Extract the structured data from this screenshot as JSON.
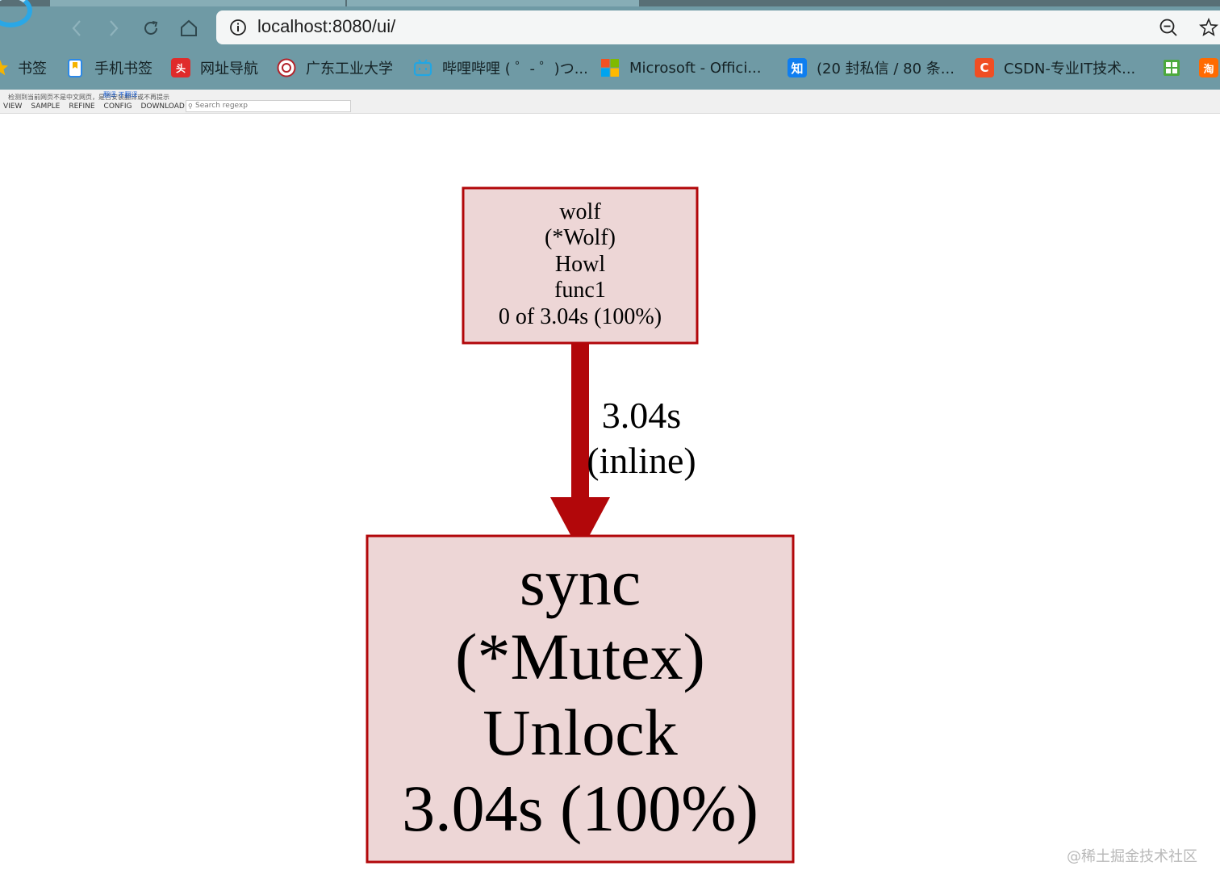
{
  "browser": {
    "url": "localhost:8080/ui/",
    "bookmarks": [
      {
        "label": "书签",
        "icon": "bookmark-star-icon",
        "color": "#f5b400"
      },
      {
        "label": "手机书签",
        "icon": "mobile-bookmark-icon",
        "color": "#2b88e8"
      },
      {
        "label": "网址导航",
        "icon": "navigation-icon",
        "color": "#e02b2b",
        "glyph": "头"
      },
      {
        "label": "广东工业大学",
        "icon": "university-seal-icon",
        "color": "#b3232b"
      },
      {
        "label": "哔哩哔哩 ( ゜- ゜)つ...",
        "icon": "bilibili-icon",
        "color": "#22a6e3"
      },
      {
        "label": "Microsoft - Offici...",
        "icon": "microsoft-icon",
        "color": "#f25022"
      },
      {
        "label": "(20 封私信 / 80 条...",
        "icon": "zhihu-icon",
        "color": "#0f7ef0",
        "glyph": "知"
      },
      {
        "label": "CSDN-专业IT技术...",
        "icon": "csdn-icon",
        "color": "#f04e23",
        "glyph": "C"
      },
      {
        "label": "",
        "icon": "grid-app-icon",
        "color": "#4ca93d"
      },
      {
        "label": "",
        "icon": "taobao-icon",
        "color": "#ff6a00",
        "glyph": "淘"
      }
    ]
  },
  "pprof": {
    "translate_notice": "检测到当前网页不是中文网页，是否安装翻译或不再提示",
    "translate_link": "翻译  不翻译",
    "menu": [
      "VIEW",
      "SAMPLE",
      "REFINE",
      "CONFIG",
      "DOWNLOAD"
    ],
    "search_placeholder": "Search regexp"
  },
  "graph": {
    "nodes": [
      {
        "id": "caller",
        "lines": [
          "wolf",
          "(*Wolf)",
          "Howl",
          "func1",
          "0 of 3.04s (100%)"
        ]
      },
      {
        "id": "callee",
        "lines": [
          "sync",
          "(*Mutex)",
          "Unlock",
          "3.04s (100%)"
        ]
      }
    ],
    "edge": {
      "lines": [
        "3.04s",
        "(inline)"
      ]
    },
    "colors": {
      "border": "#b2070a",
      "fill": "#edd6d6",
      "edge": "#b2070a"
    }
  },
  "watermark": "@稀土掘金技术社区"
}
